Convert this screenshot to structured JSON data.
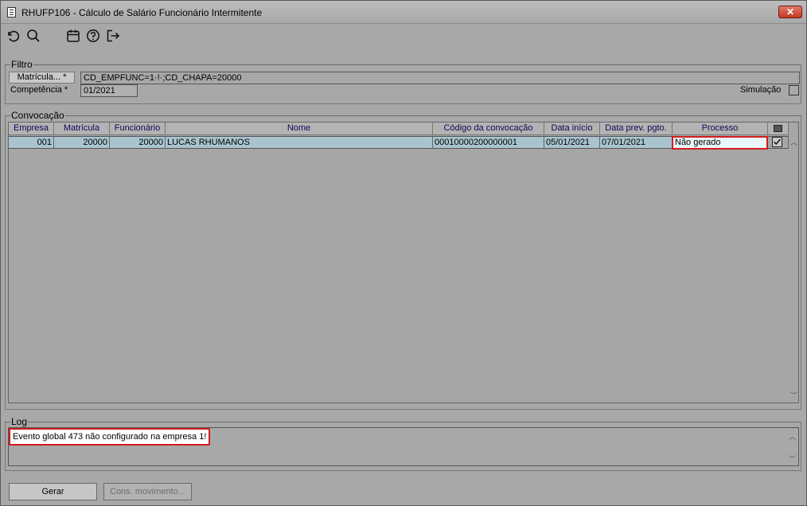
{
  "window": {
    "title": "RHUFP106 - Cálculo de Salário Funcionário Intermitente",
    "close_label": "✕"
  },
  "toolbar": {
    "icons": [
      "refresh-icon",
      "search-icon",
      "calendar-icon",
      "help-icon",
      "exit-icon"
    ]
  },
  "filtro": {
    "legend": "Filtro",
    "matricula_button": "Matrícula... *",
    "matricula_value": "CD_EMPFUNC=1·!·;CD_CHAPA=20000",
    "competencia_label": "Competência *",
    "competencia_value": "01/2021",
    "simulacao_label": "Simulação",
    "simulacao_checked": false
  },
  "convocacao": {
    "legend": "Convocação",
    "columns": [
      "Empresa",
      "Matrícula",
      "Funcionário",
      "Nome",
      "Código da convocação",
      "Data início",
      "Data prev. pgto.",
      "Processo"
    ],
    "rows": [
      {
        "empresa": "001",
        "matricula": "20000",
        "funcionario": "20000",
        "nome": "LUCAS RHUMANOS",
        "codigo": "00010000200000001",
        "data_inicio": "05/01/2021",
        "data_prev": "07/01/2021",
        "processo": "Não gerado",
        "checked": true
      }
    ]
  },
  "log": {
    "legend": "Log",
    "message": "Evento global 473 não configurado na empresa 1!"
  },
  "buttons": {
    "gerar": "Gerar",
    "cons_movimento": "Cons. movimento..."
  },
  "colors": {
    "window_bg": "#a8a8a8",
    "row_selected": "#a9c4cf",
    "highlight_border": "#d21b1b",
    "header_text": "#0a0a5a"
  }
}
